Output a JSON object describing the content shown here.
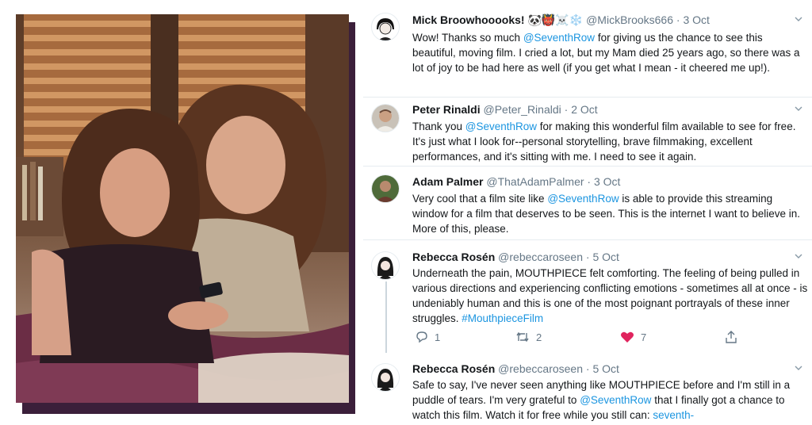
{
  "tweets": [
    {
      "name": "Mick Broowhooooks! 🐼👹☠️❄️",
      "handle": "@MickBrooks666",
      "date": "3 Oct",
      "avatar": "person-avatar",
      "text_parts": [
        "Wow! Thanks so much ",
        "@SeventhRow",
        " for giving us the chance to see this beautiful, moving film. I cried a lot, but my Mam died 25 years ago, so there was a lot of joy to be had here as well (if you get what I mean - it cheered me up!)."
      ]
    },
    {
      "name": "Peter Rinaldi",
      "handle": "@Peter_Rinaldi",
      "date": "2 Oct",
      "avatar": "person-avatar",
      "text_parts": [
        "Thank you ",
        "@SeventhRow",
        " for making this wonderful film available to see for free. It's just what I look for--personal storytelling, brave filmmaking, excellent performances, and it's sitting with me. I need to see it again."
      ]
    },
    {
      "name": "Adam Palmer",
      "handle": "@ThatAdamPalmer",
      "date": "3 Oct",
      "avatar": "person-avatar",
      "text_parts": [
        "Very cool that a film site like ",
        "@SeventhRow",
        " is able to provide this streaming window for a film that deserves to be seen. This is the internet I want to believe in. More of this, please."
      ]
    },
    {
      "name": "Rebecca Rosén",
      "handle": "@rebeccaroseen",
      "date": "5 Oct",
      "avatar": "person-avatar",
      "text_parts": [
        "Underneath the pain, MOUTHPIECE felt comforting. The feeling of being pulled in various directions and experiencing conflicting emotions - sometimes all at once - is undeniably human and this is one of the most poignant portrayals of these inner struggles. ",
        "#MouthpieceFilm",
        ""
      ],
      "actions": {
        "replies": "1",
        "retweets": "2",
        "likes": "7"
      }
    },
    {
      "name": "Rebecca Rosén",
      "handle": "@rebeccaroseen",
      "date": "5 Oct",
      "avatar": "person-avatar",
      "text_parts": [
        "Safe to say, I've never seen anything like MOUTHPIECE before and I'm still in a puddle of tears. I'm very grateful to ",
        "@SeventhRow",
        " that I finally got a chance to watch this film. Watch it for free while you still can: ",
        "seventh-"
      ]
    }
  ],
  "separator": "·",
  "colors": {
    "link": "#1b95e0",
    "name": "#14171a",
    "muted": "#657786",
    "like": "#e0245e",
    "photo_border": "#3b1f3a"
  },
  "icons": [
    "reply-icon",
    "retweet-icon",
    "like-icon",
    "share-icon",
    "chevron-down-icon"
  ]
}
